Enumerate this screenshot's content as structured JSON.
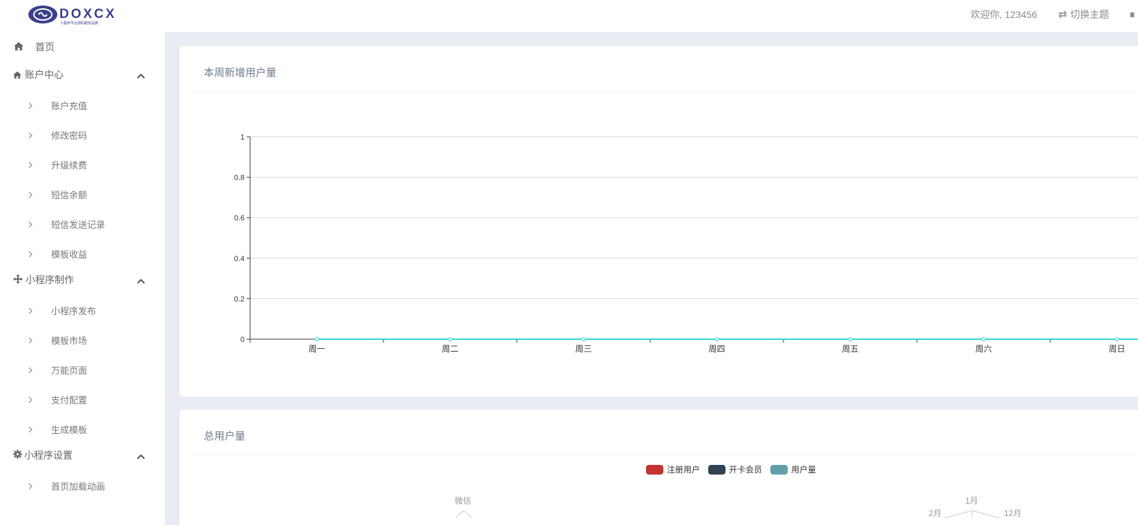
{
  "header": {
    "logo_text": "DOXCX",
    "logo_subtext": "小程序平台源码服务品牌",
    "welcome": "欢迎你, 123456",
    "switch_theme": "切换主题",
    "colors": {
      "logo_primary": "#3b3f8c",
      "text": "#8a8a8a"
    }
  },
  "sidebar": {
    "items": [
      {
        "type": "top",
        "icon": "home-icon",
        "label": "首页"
      },
      {
        "type": "group",
        "icon": "home-icon",
        "label": "账户中心",
        "expanded": true
      },
      {
        "type": "sub",
        "label": "账户充值"
      },
      {
        "type": "sub",
        "label": "修改密码"
      },
      {
        "type": "sub",
        "label": "升级续费"
      },
      {
        "type": "sub",
        "label": "短信余额"
      },
      {
        "type": "sub",
        "label": "短信发送记录"
      },
      {
        "type": "sub",
        "label": "模板收益"
      },
      {
        "type": "group",
        "icon": "move-icon",
        "label": "小程序制作",
        "expanded": true
      },
      {
        "type": "sub",
        "label": "小程序发布"
      },
      {
        "type": "sub",
        "label": "模板市场"
      },
      {
        "type": "sub",
        "label": "万能页面"
      },
      {
        "type": "sub",
        "label": "支付配置"
      },
      {
        "type": "sub",
        "label": "生成模板"
      },
      {
        "type": "group",
        "icon": "gear-icon",
        "label": "小程序设置",
        "expanded": true
      },
      {
        "type": "sub",
        "label": "首页加载动画"
      }
    ]
  },
  "main": {
    "card1_title": "本周新增用户量",
    "card2_title": "总用户量",
    "legend": [
      {
        "name": "注册用户",
        "color": "#c23531"
      },
      {
        "name": "开卡会员",
        "color": "#2f4554"
      },
      {
        "name": "用户量",
        "color": "#61a0a8"
      }
    ],
    "pie_labels": {
      "left": "微信",
      "right_top": "1月",
      "right_left": "2月",
      "right_right": "12月"
    }
  },
  "chart_data": {
    "type": "line",
    "title": "本周新增用户量",
    "categories": [
      "周一",
      "周二",
      "周三",
      "周四",
      "周五",
      "周六",
      "周日"
    ],
    "series": [
      {
        "values": [
          0,
          0,
          0,
          0,
          0,
          0,
          0
        ],
        "color": "#2ed7d0"
      }
    ],
    "ylim": [
      0,
      1
    ],
    "yticks": [
      0,
      0.2,
      0.4,
      0.6,
      0.8,
      1
    ],
    "grid": true
  }
}
